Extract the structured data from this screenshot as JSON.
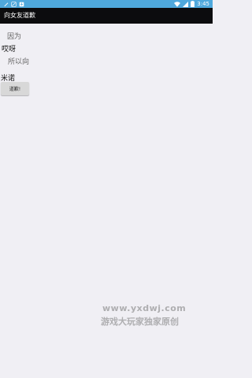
{
  "status_bar": {
    "time": "3:45",
    "left_icons": [
      "settings-icon",
      "wifi-off-icon",
      "download-icon"
    ],
    "right_icons": [
      "wifi-icon",
      "signal-icon",
      "battery-icon"
    ],
    "background": "#4fa8dc"
  },
  "app": {
    "title": "向女友道歉",
    "title_bar_background": "#0c0c0e"
  },
  "content": {
    "line1": "因为",
    "line2": "哎呀",
    "line3": "所以向",
    "name_input_value": "米诺",
    "button_label": "道歉!"
  },
  "watermark": {
    "url": "www.yxdwj.com",
    "text": "游戏大玩家独家原创"
  },
  "colors": {
    "background": "#f0eff4",
    "input_underline": "#e0245e"
  }
}
